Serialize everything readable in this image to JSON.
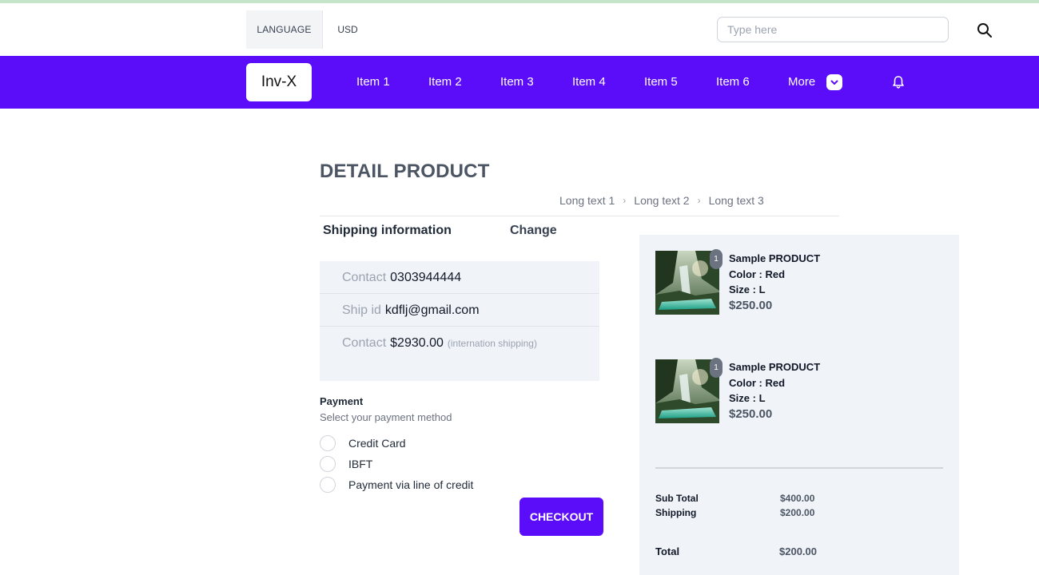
{
  "header": {
    "language_label": "LANGUAGE",
    "currency_label": "USD",
    "search_placeholder": "Type here"
  },
  "nav": {
    "logo": "Inv-X",
    "items": [
      "Item 1",
      "Item 2",
      "Item 3",
      "Item 4",
      "Item 5",
      "Item 6"
    ],
    "more_label": "More",
    "icons": {
      "search": "search-icon",
      "more": "chevron-down-icon",
      "notifications": "bell-icon"
    },
    "brand_color": "#5b0cf9"
  },
  "page": {
    "title": "DETAIL PRODUCT",
    "breadcrumb": [
      "Long text 1",
      "Long text 2",
      "Long text 3"
    ]
  },
  "shipping": {
    "title": "Shipping information",
    "change_label": "Change",
    "rows": [
      {
        "label": "Contact",
        "value": "0303944444",
        "note": ""
      },
      {
        "label": "Ship id",
        "value": "kdflj@gmail.com",
        "note": ""
      },
      {
        "label": "Contact",
        "value": "$2930.00",
        "note": "(internation shipping)"
      }
    ]
  },
  "payment": {
    "title": "Payment",
    "subtitle": "Select your payment method",
    "options": [
      "Credit Card",
      "IBFT",
      "Payment via line of credit"
    ],
    "checkout_label": "CHECKOUT"
  },
  "cart": {
    "items": [
      {
        "name": "Sample PRODUCT",
        "color": "Color : Red",
        "size": "Size : L",
        "price": "$250.00",
        "qty": "1",
        "image": "waterfall-forest-image"
      },
      {
        "name": "Sample PRODUCT",
        "color": "Color : Red",
        "size": "Size : L",
        "price": "$250.00",
        "qty": "1",
        "image": "waterfall-forest-image"
      }
    ],
    "subtotal_label": "Sub Total",
    "subtotal_value": "$400.00",
    "shipping_label": "Shipping",
    "shipping_value": "$200.00",
    "total_label": "Total",
    "total_value": "$200.00"
  }
}
